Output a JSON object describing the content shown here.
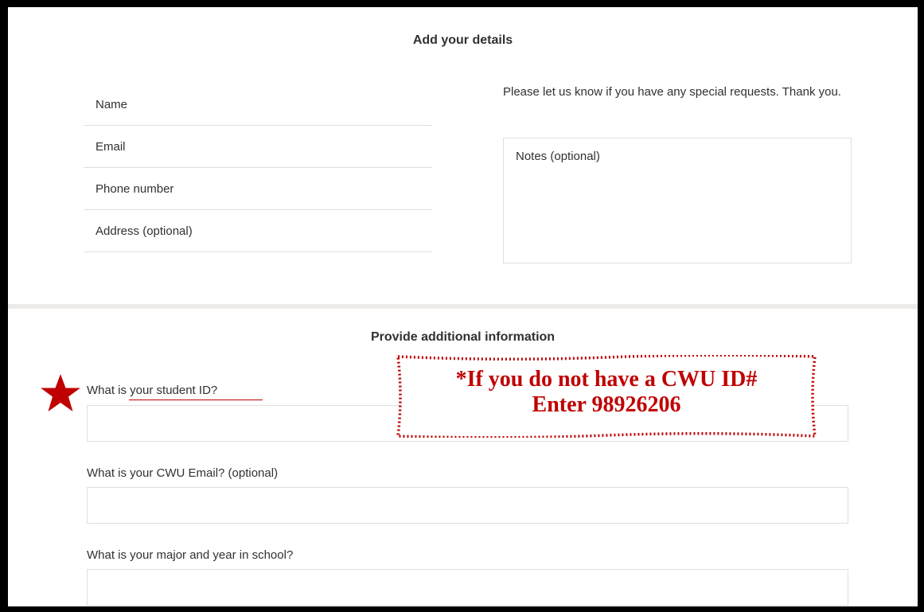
{
  "details": {
    "title": "Add your details",
    "fields": [
      {
        "placeholder": "Name"
      },
      {
        "placeholder": "Email"
      },
      {
        "placeholder": "Phone number"
      },
      {
        "placeholder": "Address (optional)"
      }
    ],
    "requests_text": "Please let us know if you have any special requests. Thank you.",
    "notes_placeholder": "Notes (optional)"
  },
  "additional": {
    "title": "Provide additional information",
    "questions": [
      {
        "label": "What is your student ID?",
        "value": ""
      },
      {
        "label": "What is your CWU Email? (optional)",
        "value": ""
      },
      {
        "label": "What is your major and year in school?",
        "value": ""
      }
    ]
  },
  "annotation": {
    "line1": "*If you do not have a CWU ID#",
    "line2": "Enter 98926206",
    "color": "#c00000",
    "marker_icon": "star-icon"
  }
}
